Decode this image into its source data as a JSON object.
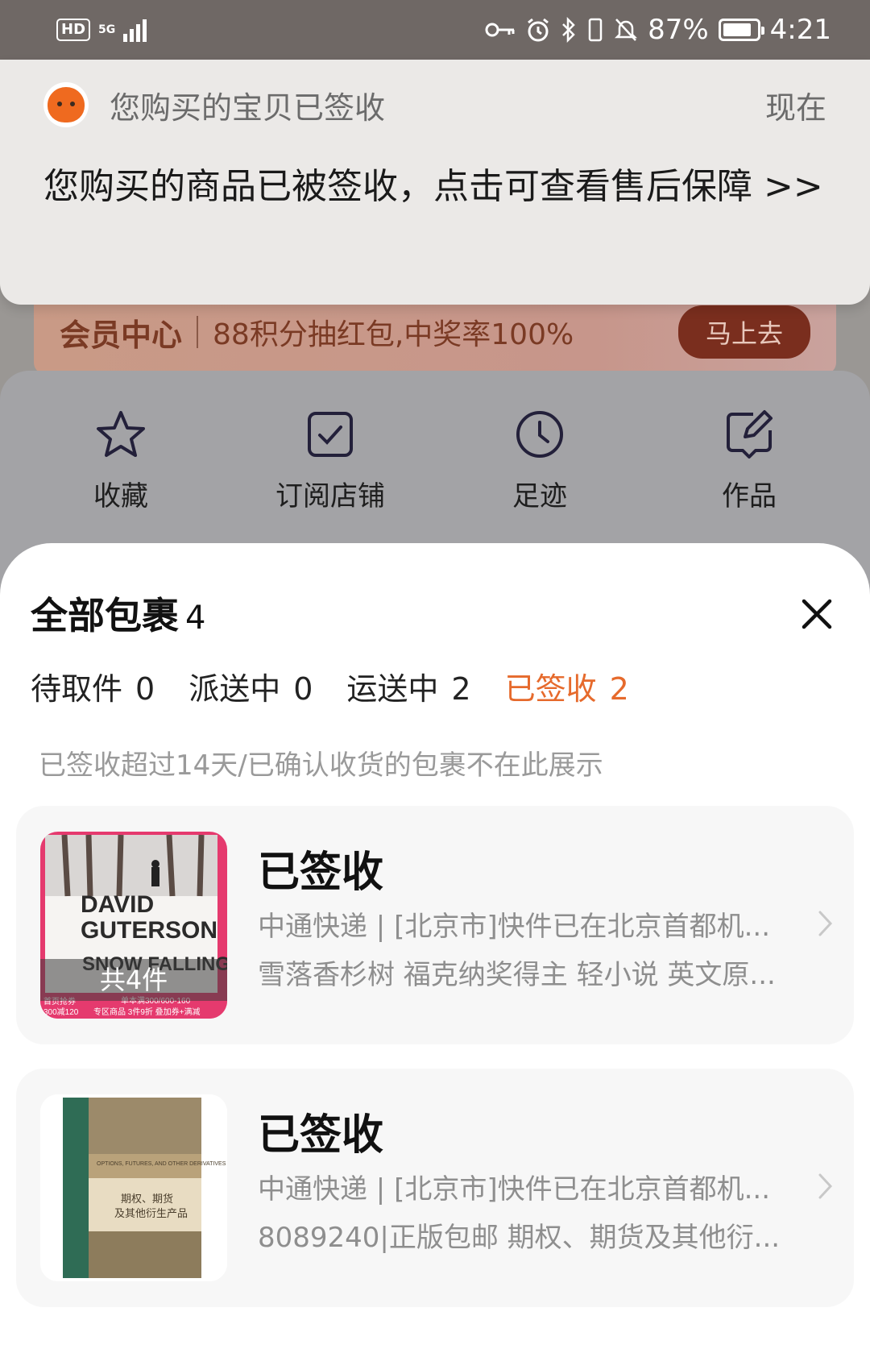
{
  "status_bar": {
    "hd": "HD",
    "network": "5G",
    "battery": "87%",
    "battery_level": 0.87,
    "time": "4:21"
  },
  "background": {
    "member_title": "会员中心",
    "member_text": "88积分抽红包,中奖率100%",
    "member_button": "马上去",
    "quick_items": [
      "收藏",
      "订阅店铺",
      "足迹",
      "作品"
    ]
  },
  "notification": {
    "app_title": "您购买的宝贝已签收",
    "time": "现在",
    "body": "您购买的商品已被签收，点击可查看售后保障 >>"
  },
  "sheet": {
    "title": "全部包裹",
    "count": "4",
    "tabs": [
      {
        "label": "待取件",
        "count": "0"
      },
      {
        "label": "派送中",
        "count": "0"
      },
      {
        "label": "运送中",
        "count": "2"
      },
      {
        "label": "已签收",
        "count": "2"
      }
    ],
    "active_tab": "已签收",
    "notice": "已签收超过14天/已确认收货的包裹不在此展示",
    "packages": [
      {
        "status": "已签收",
        "logistics": "中通快递 | [北京市]快件已在北京首都机...",
        "product": "雪落香杉树 福克纳奖得主 轻小说 英文原...",
        "item_count": "共4件",
        "cover": {
          "author1": "DAVID",
          "author2": "GUTERSON",
          "title": "SNOW FALLING",
          "promo_left": "首页抢券",
          "promo_left2": "300减120",
          "promo_right": "单本满300/600-160",
          "promo_bottom": "专区商品 3件9折 叠加券+满减"
        }
      },
      {
        "status": "已签收",
        "logistics": "中通快递 | [北京市]快件已在北京首都机...",
        "product": "8089240|正版包邮 期权、期货及其他衍...",
        "cover": {
          "title_cn": "期权、期货",
          "subtitle_cn": "及其他衍生产品",
          "title_en": "OPTIONS, FUTURES, AND OTHER DERIVATIVES"
        }
      }
    ]
  },
  "colors": {
    "accent": "#e66a2c",
    "status_bar": "#6f6865"
  }
}
